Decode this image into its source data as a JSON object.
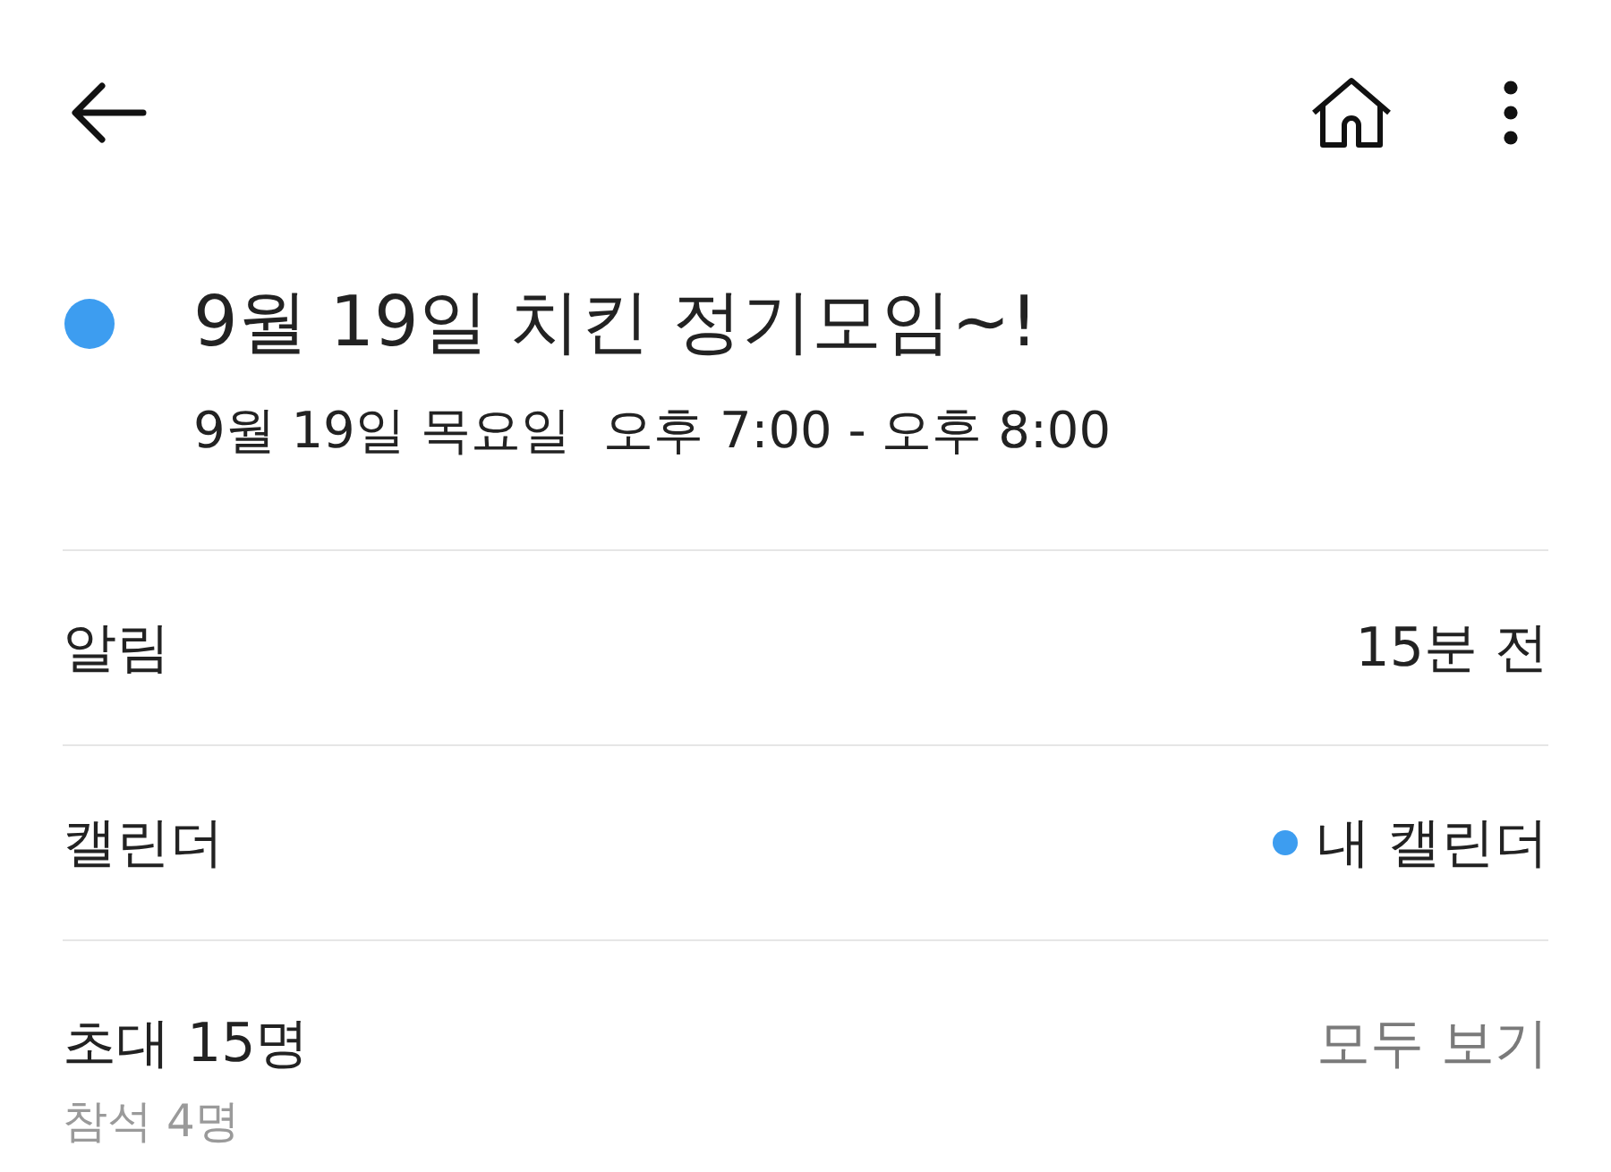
{
  "event": {
    "title": "9월 19일 치킨 정기모임~!",
    "datetime": "9월 19일 목요일  오후 7:00 - 오후 8:00",
    "color": "#3d9df0"
  },
  "details": [
    {
      "kind": "value",
      "label": "알림",
      "value": "15분 전"
    },
    {
      "kind": "calendar",
      "label": "캘린더",
      "value": "내 캘린더",
      "color": "#3d9df0"
    },
    {
      "kind": "invitees",
      "label": "초대 15명",
      "sublabel": "참석 4명",
      "action": "모두 보기"
    }
  ]
}
